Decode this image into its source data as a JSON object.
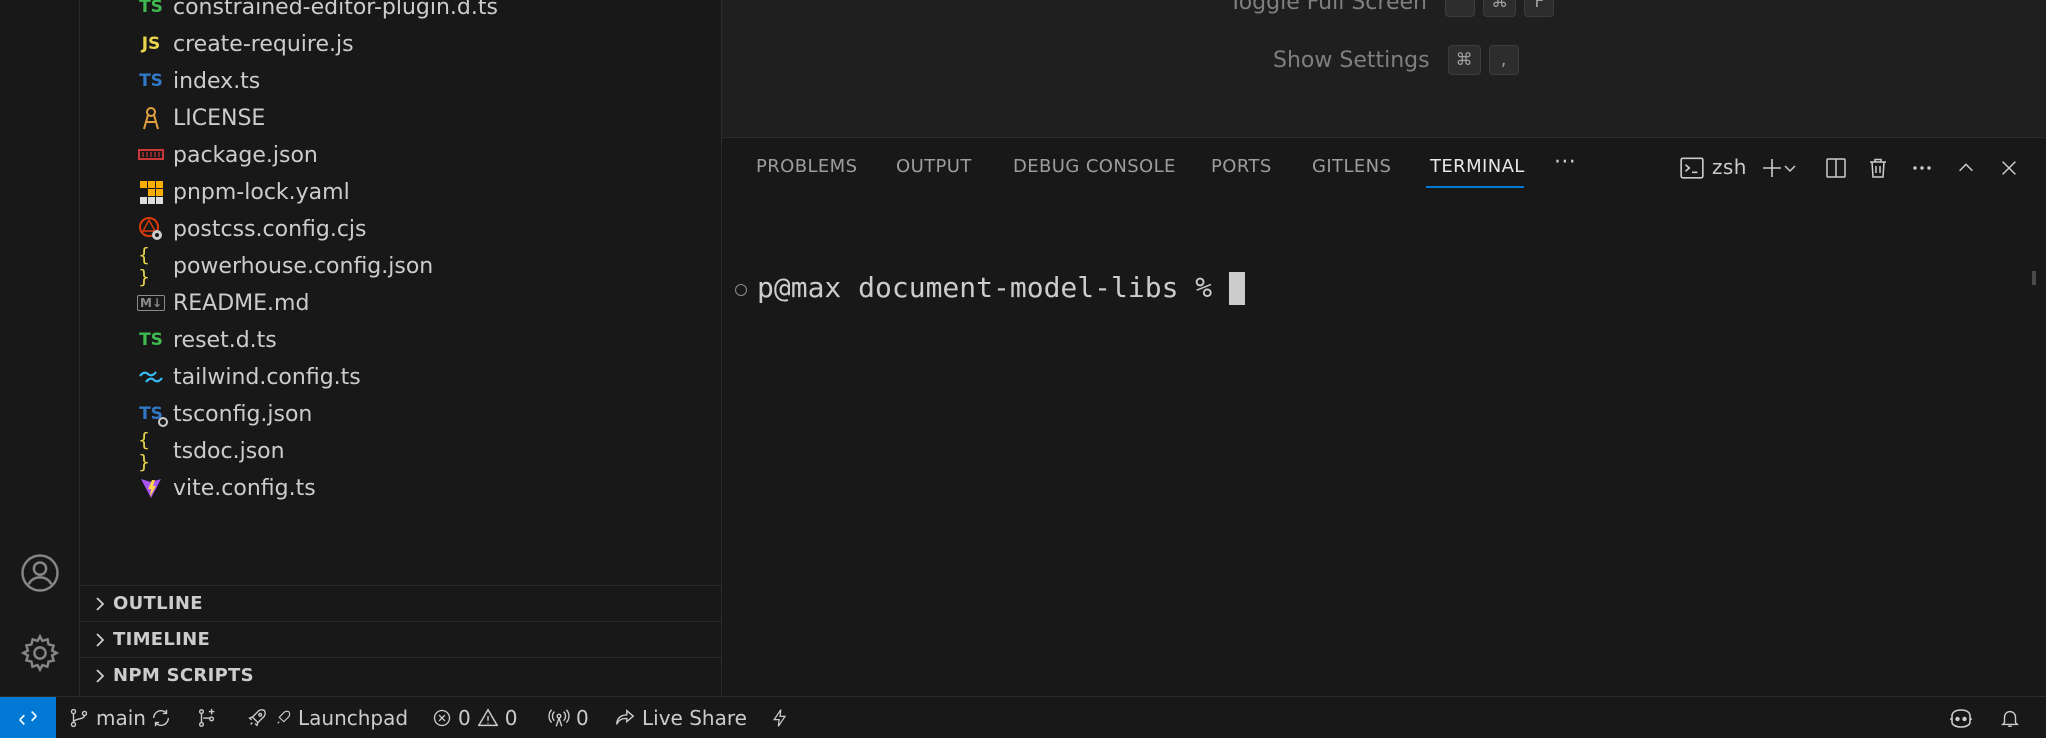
{
  "explorer": {
    "files": [
      {
        "name": "constrained-editor-plugin.d.ts",
        "icon": "typescript-icon",
        "glyph": "TS",
        "color": "#3fb950"
      },
      {
        "name": "create-require.js",
        "icon": "javascript-icon",
        "glyph": "JS",
        "color": "#e8d44d"
      },
      {
        "name": "index.ts",
        "icon": "typescript-icon",
        "glyph": "TS",
        "color": "#3178c6"
      },
      {
        "name": "LICENSE",
        "icon": "license-icon",
        "glyph": "",
        "color": "#e0a040"
      },
      {
        "name": "package.json",
        "icon": "npm-icon",
        "glyph": "",
        "color": "#cb3837"
      },
      {
        "name": "pnpm-lock.yaml",
        "icon": "pnpm-icon",
        "glyph": "",
        "color": "#f9ad00"
      },
      {
        "name": "postcss.config.cjs",
        "icon": "postcss-icon",
        "glyph": "",
        "color": "#dd3a0a"
      },
      {
        "name": "powerhouse.config.json",
        "icon": "json-icon",
        "glyph": "{ }",
        "color": "#e8d44d"
      },
      {
        "name": "README.md",
        "icon": "markdown-icon",
        "glyph": "M↓",
        "color": "#8a8a8a"
      },
      {
        "name": "reset.d.ts",
        "icon": "typescript-icon",
        "glyph": "TS",
        "color": "#3fb950"
      },
      {
        "name": "tailwind.config.ts",
        "icon": "tailwind-icon",
        "glyph": "",
        "color": "#38bdf8"
      },
      {
        "name": "tsconfig.json",
        "icon": "tsconfig-icon",
        "glyph": "TS",
        "color": "#3178c6"
      },
      {
        "name": "tsdoc.json",
        "icon": "json-icon",
        "glyph": "{ }",
        "color": "#e8d44d"
      },
      {
        "name": "vite.config.ts",
        "icon": "vite-icon",
        "glyph": "",
        "color": "#a855f7"
      }
    ],
    "sections": [
      "OUTLINE",
      "TIMELINE",
      "NPM SCRIPTS"
    ]
  },
  "editor": {
    "commands": [
      {
        "label": "Toggle Full Screen",
        "keys": [
          "^",
          "⌘",
          "F"
        ]
      },
      {
        "label": "Show Settings",
        "keys": [
          "⌘",
          ","
        ]
      }
    ]
  },
  "panel": {
    "tabs": [
      "PROBLEMS",
      "OUTPUT",
      "DEBUG CONSOLE",
      "PORTS",
      "GITLENS",
      "TERMINAL"
    ],
    "active_tab": "TERMINAL",
    "more_label": "···",
    "terminal_name": "zsh",
    "prompt": "p@max document-model-libs % "
  },
  "status_bar": {
    "branch": "main",
    "launchpad": "Launchpad",
    "errors": "0",
    "warnings": "0",
    "ports": "0",
    "live_share": "Live Share"
  },
  "colors": {
    "accent": "#0078d4",
    "background": "#181818",
    "editor_background": "#1f1f1f",
    "border": "#2b2b2b"
  }
}
